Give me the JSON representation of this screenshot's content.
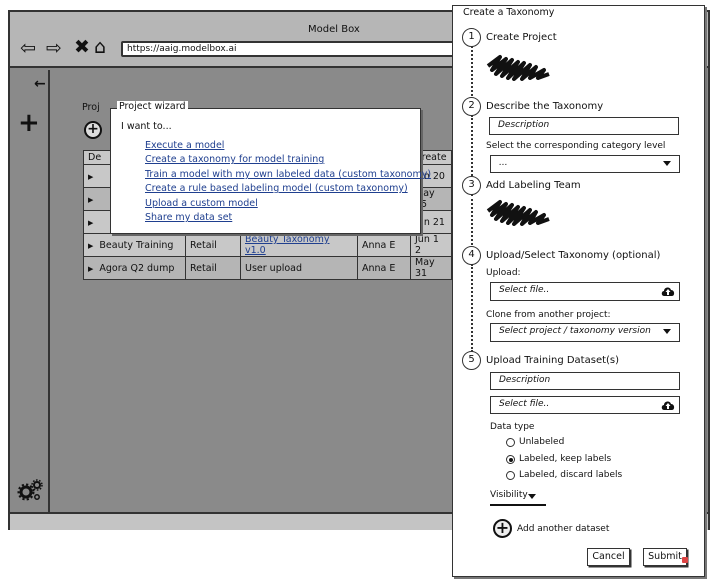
{
  "browser": {
    "window_title": "Model Box",
    "url": "https://aaig.modelbox.ai",
    "nav_icons": [
      "back-arrow-icon",
      "forward-arrow-icon",
      "close-x-icon",
      "home-icon"
    ]
  },
  "sidebar": {
    "collapse_icon": "left-arrow-icon",
    "add_icon": "plus-icon",
    "settings_icon": "gears-icon"
  },
  "content": {
    "projects_label": "Proj",
    "column_headers": [
      "De",
      "",
      "",
      "",
      "Create"
    ],
    "partial_rows": [
      {
        "date": "Jun 20"
      },
      {
        "date": "May 05"
      },
      {
        "date": "Jun 21"
      }
    ],
    "rows": [
      {
        "name": "Beauty Training",
        "category": "Retail",
        "taxonomy": "Beauty Taxonomy v1.0",
        "owner": "Anna E",
        "date": "Jun 1 2"
      },
      {
        "name": "Agora Q2 dump",
        "category": "Retail",
        "taxonomy": "User upload",
        "owner": "Anna E",
        "date": "May 31"
      }
    ]
  },
  "wizard": {
    "title": "Project wizard",
    "prompt": "I want to...",
    "options": [
      "Execute a model",
      "Create a taxonomy for model training",
      "Train a model with my own labeled data (custom taxonomy)",
      "Create a rule based labeling model (custom taxonomy)",
      "Upload a custom model",
      "Share my data set"
    ]
  },
  "panel": {
    "title": "Create a Taxonomy",
    "step1": {
      "num": "1",
      "heading": "Create Project"
    },
    "step2": {
      "num": "2",
      "heading": "Describe the Taxonomy",
      "description_placeholder": "Description",
      "category_label": "Select the corresponding category level",
      "category_value": "..."
    },
    "step3": {
      "num": "3",
      "heading": "Add Labeling Team"
    },
    "step4": {
      "num": "4",
      "heading": "Upload/Select Taxonomy (optional)",
      "upload_label": "Upload:",
      "upload_placeholder": "Select file..",
      "clone_label": "Clone from another project:",
      "clone_value": "Select project / taxonomy version"
    },
    "step5": {
      "num": "5",
      "heading": "Upload Training Dataset(s)",
      "description_placeholder": "Description",
      "file_placeholder": "Select file..",
      "data_type_label": "Data type",
      "data_types": [
        "Unlabeled",
        "Labeled, keep labels",
        "Labeled, discard labels"
      ],
      "selected_data_type": "Labeled, keep labels",
      "visibility_label": "Visibility",
      "add_dataset_label": "Add another dataset"
    },
    "cancel_label": "Cancel",
    "submit_label": "Submit"
  }
}
